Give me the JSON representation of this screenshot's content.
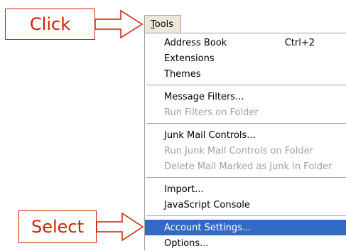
{
  "annotations": {
    "click_label": "Click",
    "select_label": "Select",
    "color": "#d02000"
  },
  "menu": {
    "title": "Tools",
    "items": [
      {
        "label": "Address Book",
        "shortcut": "Ctrl+2",
        "enabled": true
      },
      {
        "label": "Extensions",
        "enabled": true
      },
      {
        "label": "Themes",
        "enabled": true
      },
      {
        "label": "Message Filters...",
        "enabled": true
      },
      {
        "label": "Run Filters on Folder",
        "enabled": false
      },
      {
        "label": "Junk Mail Controls...",
        "enabled": true
      },
      {
        "label": "Run Junk Mail Controls on Folder",
        "enabled": false
      },
      {
        "label": "Delete Mail Marked as Junk in Folder",
        "enabled": false
      },
      {
        "label": "Import...",
        "enabled": true
      },
      {
        "label": "JavaScript Console",
        "enabled": true
      },
      {
        "label": "Account Settings...",
        "enabled": true,
        "selected": true
      },
      {
        "label": "Options...",
        "enabled": true
      }
    ],
    "highlight_color": "#316ac5"
  }
}
